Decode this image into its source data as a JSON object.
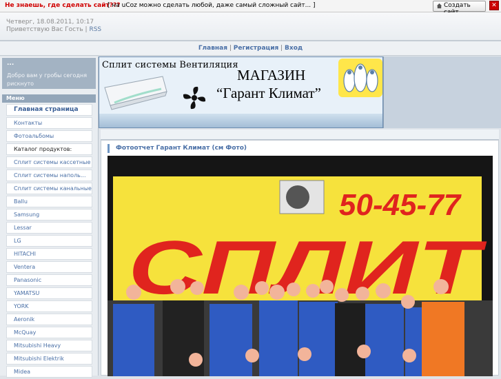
{
  "topbar": {
    "promo": "Не знаешь, где сделать сайт???",
    "teaser": "[ на uCoz можно сделать любой, даже самый сложный сайт... ]",
    "create_label": "Создать сайт"
  },
  "header": {
    "date": "Четверг, 18.08.2011, 10:17",
    "greeting": "Приветствую Вас Гость",
    "rss": "RSS"
  },
  "nav": {
    "home": "Главная",
    "register": "Регистрация",
    "login": "Вход"
  },
  "sidebar": {
    "welcome_dots": "...",
    "welcome_text": "Добро вам у гробы сегодня рискнуто",
    "menu_title": "Меню",
    "items": [
      {
        "label": "Главная страница"
      },
      {
        "label": "Контакты"
      },
      {
        "label": "Фотоальбомы"
      },
      {
        "label": "Каталог продуктов:"
      },
      {
        "label": "Сплит системы кассетные"
      },
      {
        "label": "Сплит системы наполь..."
      },
      {
        "label": "Сплит системы канальные"
      },
      {
        "label": "Ballu"
      },
      {
        "label": "Samsung"
      },
      {
        "label": "Lessar"
      },
      {
        "label": "LG"
      },
      {
        "label": "HITACHI"
      },
      {
        "label": "Ventera"
      },
      {
        "label": "Panasonic"
      },
      {
        "label": "YAMATSU"
      },
      {
        "label": "YORK"
      },
      {
        "label": "Aeronik"
      },
      {
        "label": "McQuay"
      },
      {
        "label": "Mitsubishi Heavy"
      },
      {
        "label": "Mitsubishi Elektrik"
      },
      {
        "label": "Midea"
      }
    ]
  },
  "banner": {
    "categories": "Сплит системы   Вентиляция",
    "shop": "МАГАЗИН",
    "brand": "“Гарант Климат”"
  },
  "post": {
    "title": "Фотоотчет Гарант Климат (см Фото)",
    "photo_phone": "50-45-77",
    "photo_sign": "СПЛИТ"
  },
  "colors": {
    "accent": "#496fa6",
    "promo_red": "#d00000",
    "menu_head": "#93a6b9"
  }
}
